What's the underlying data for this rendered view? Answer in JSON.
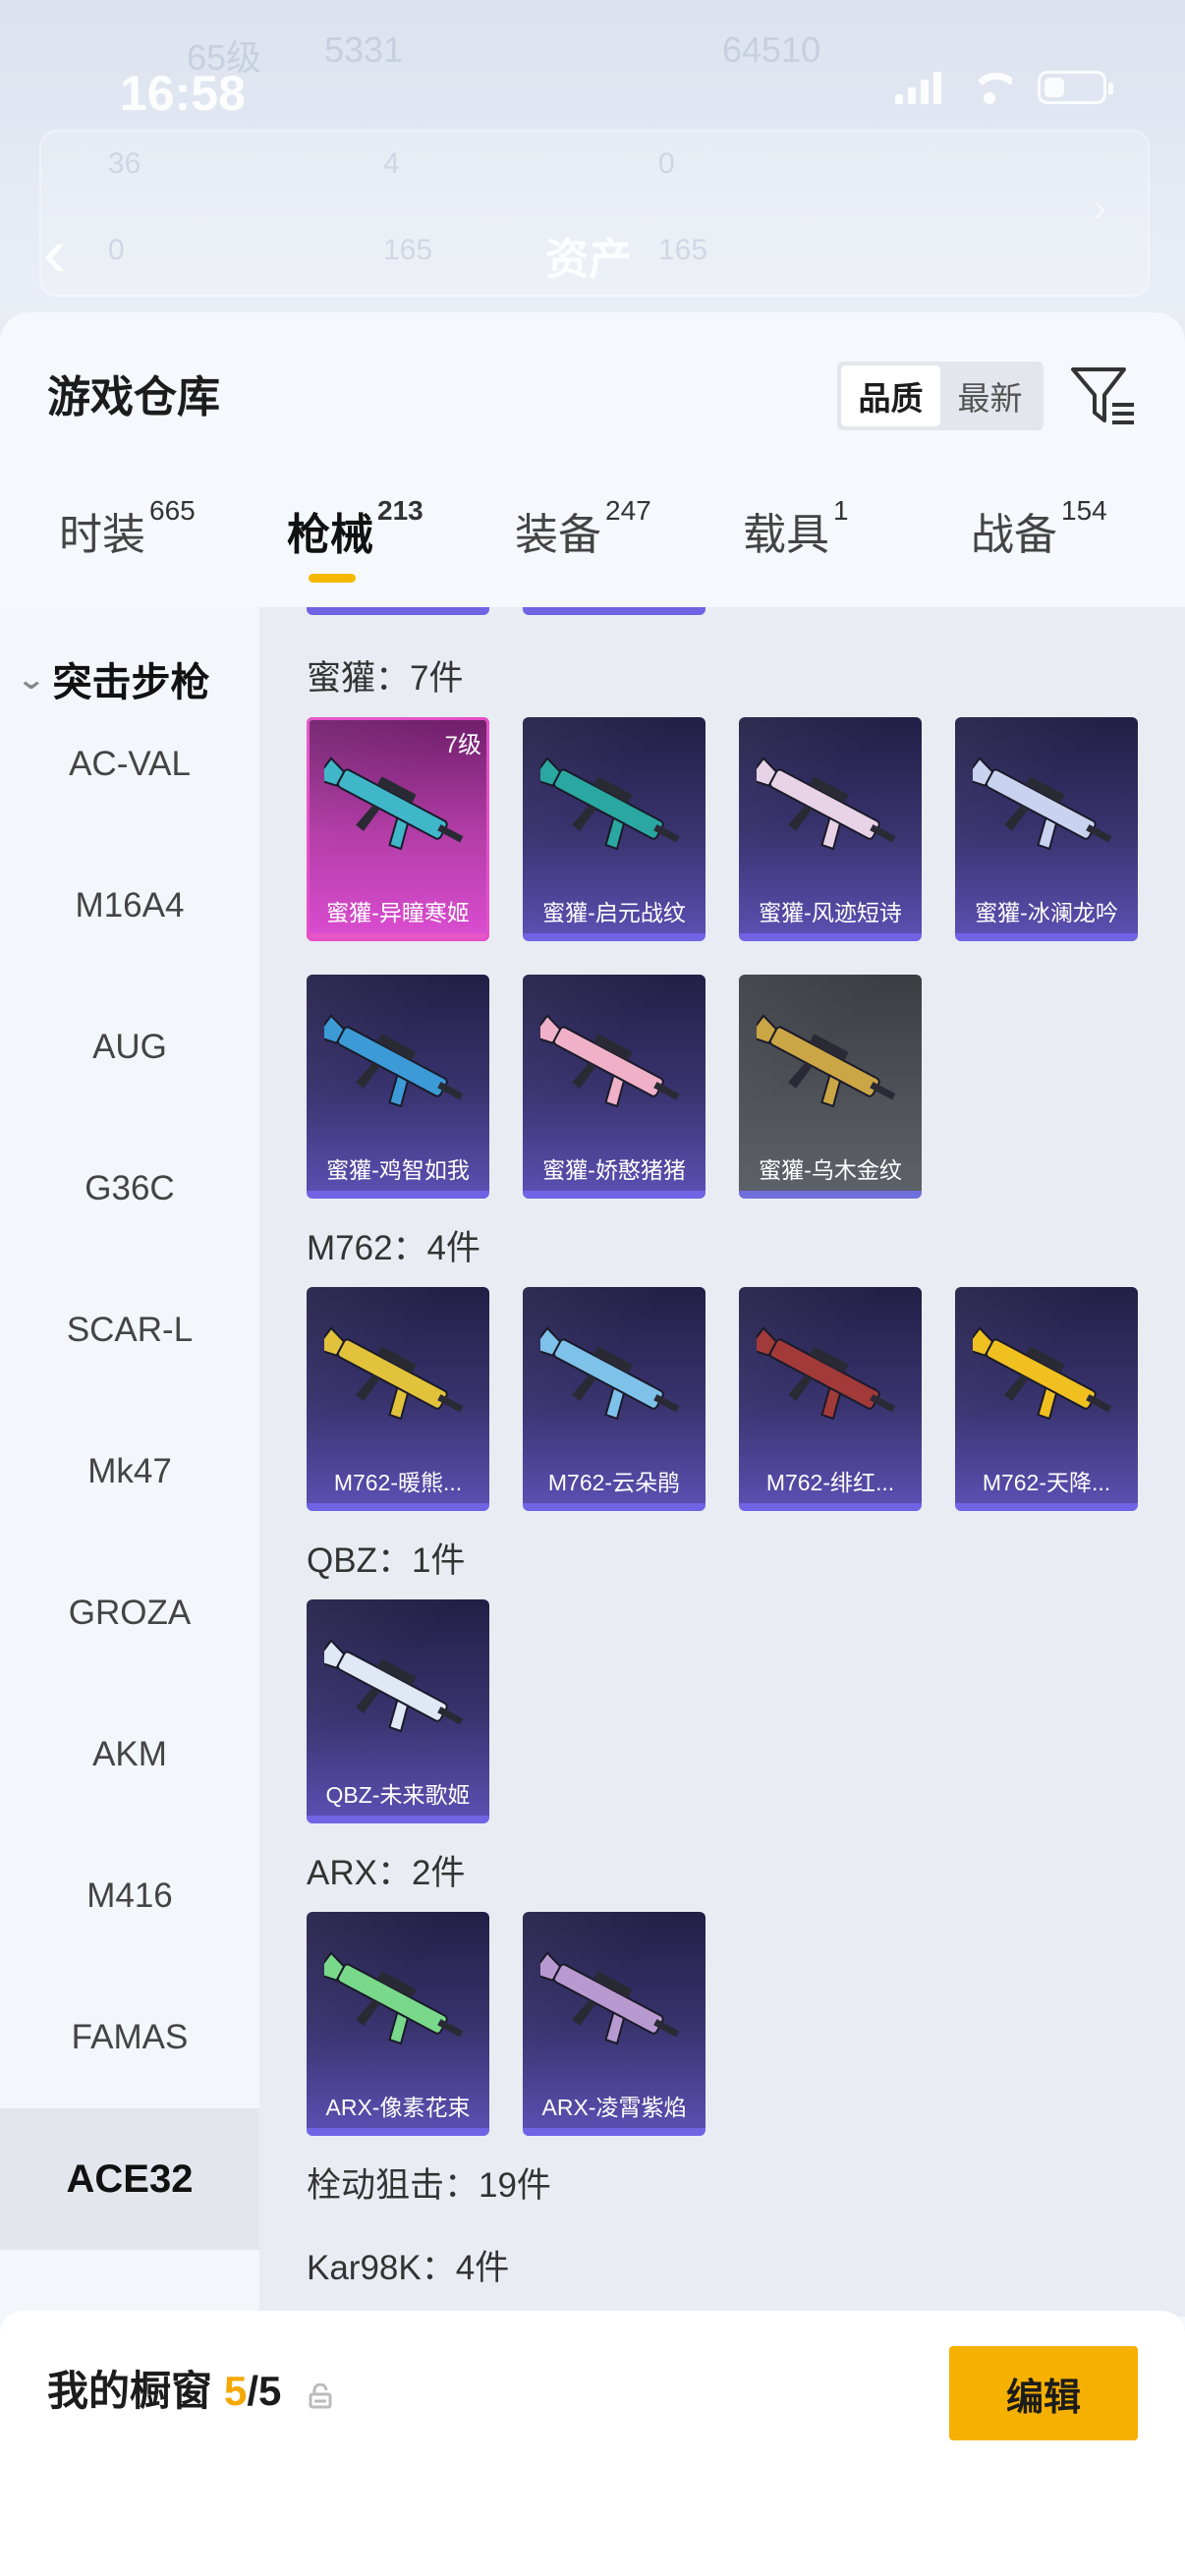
{
  "status_bar": {
    "time": "16:58"
  },
  "background": {
    "title": "资产",
    "ghost_texts": [
      "65级",
      "5331",
      "64510"
    ],
    "row1": [
      "36",
      "4",
      "0"
    ],
    "row2": [
      "0",
      "165",
      "165"
    ]
  },
  "sheet": {
    "title": "游戏仓库",
    "sort": {
      "options": [
        "品质",
        "最新"
      ],
      "selected": "品质"
    }
  },
  "tabs": [
    {
      "label": "时装",
      "count": "665"
    },
    {
      "label": "枪械",
      "count": "213",
      "active": true
    },
    {
      "label": "装备",
      "count": "247"
    },
    {
      "label": "载具",
      "count": "1"
    },
    {
      "label": "战备",
      "count": "154"
    }
  ],
  "sidebar": {
    "category": "突击步枪",
    "items": [
      "AC-VAL",
      "M16A4",
      "AUG",
      "G36C",
      "SCAR-L",
      "Mk47",
      "GROZA",
      "AKM",
      "M416",
      "FAMAS",
      "ACE32"
    ],
    "active_item": "ACE32"
  },
  "groups": [
    {
      "label": "蜜獾：7件",
      "items": [
        {
          "name": "蜜獾-异瞳寒姬",
          "badge": "7级",
          "style": "pink",
          "color": "#3fb7c9"
        },
        {
          "name": "蜜獾-启元战纹",
          "style": "purple",
          "color": "#2aa7a0"
        },
        {
          "name": "蜜獾-风迹短诗",
          "style": "purple",
          "color": "#e8d2e6"
        },
        {
          "name": "蜜獾-冰澜龙吟",
          "style": "purple",
          "color": "#c9d3f0"
        },
        {
          "name": "蜜獾-鸡智如我",
          "style": "purple",
          "color": "#3c9bd6"
        },
        {
          "name": "蜜獾-娇憨猪猪",
          "style": "purple",
          "color": "#f0b0c8"
        },
        {
          "name": "蜜獾-乌木金纹",
          "style": "gray",
          "color": "#caa645"
        }
      ]
    },
    {
      "label": "M762：4件",
      "items": [
        {
          "name": "M762-暖熊...",
          "style": "purple",
          "color": "#e2c23a"
        },
        {
          "name": "M762-云朵鹃",
          "style": "purple",
          "color": "#7ec2ea"
        },
        {
          "name": "M762-绯红...",
          "style": "purple",
          "color": "#a23a3a"
        },
        {
          "name": "M762-天降...",
          "style": "purple",
          "color": "#f0c020"
        }
      ]
    },
    {
      "label": "QBZ：1件",
      "items": [
        {
          "name": "QBZ-未来歌姬",
          "style": "purple",
          "color": "#dfe8f4"
        }
      ]
    },
    {
      "label": "ARX：2件",
      "items": [
        {
          "name": "ARX-像素花束",
          "style": "purple",
          "color": "#79d98a"
        },
        {
          "name": "ARX-凌霄紫焰",
          "style": "purple",
          "color": "#b89ad0"
        }
      ]
    },
    {
      "label": "栓动狙击：19件",
      "items": []
    },
    {
      "label": "Kar98K：4件",
      "items": []
    }
  ],
  "showcase": {
    "title": "我的橱窗",
    "count": "5",
    "total": "/5"
  },
  "edit_label": "编辑",
  "accent_color": "#f5b800"
}
